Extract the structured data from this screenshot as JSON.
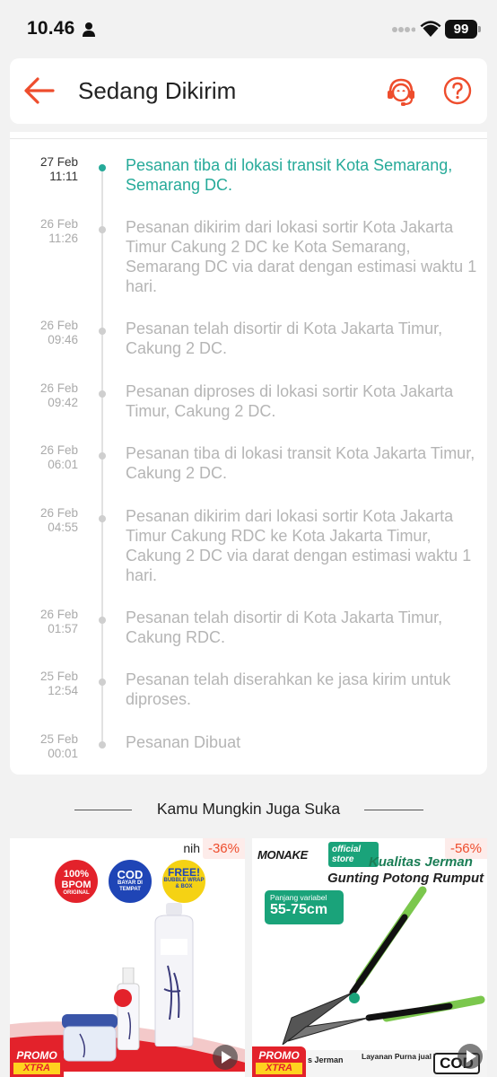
{
  "status_bar": {
    "time": "10.46",
    "battery": "99"
  },
  "header": {
    "title": "Sedang Dikirim"
  },
  "colors": {
    "accent": "#ee4d2d",
    "active_status": "#26aa99",
    "inactive_text": "#b5b5b5"
  },
  "timeline": [
    {
      "date": "27 Feb",
      "time": "11:11",
      "text": "Pesanan tiba di lokasi transit Kota Semarang, Semarang DC.",
      "active": true
    },
    {
      "date": "26 Feb",
      "time": "11:26",
      "text": "Pesanan dikirim dari lokasi sortir Kota Jakarta Timur  Cakung 2 DC ke Kota Semarang, Semarang DC via darat dengan estimasi waktu 1 hari.",
      "active": false
    },
    {
      "date": "26 Feb",
      "time": "09:46",
      "text": "Pesanan telah disortir di Kota Jakarta Timur, Cakung 2 DC.",
      "active": false
    },
    {
      "date": "26 Feb",
      "time": "09:42",
      "text": "Pesanan diproses di lokasi sortir Kota Jakarta Timur, Cakung 2 DC.",
      "active": false
    },
    {
      "date": "26 Feb",
      "time": "06:01",
      "text": "Pesanan tiba di lokasi transit Kota Jakarta Timur, Cakung 2 DC.",
      "active": false
    },
    {
      "date": "26 Feb",
      "time": "04:55",
      "text": "Pesanan dikirim dari lokasi sortir Kota Jakarta Timur  Cakung RDC ke Kota Jakarta Timur, Cakung 2 DC via darat dengan estimasi waktu 1 hari.",
      "active": false
    },
    {
      "date": "26 Feb",
      "time": "01:57",
      "text": "Pesanan telah disortir di Kota Jakarta Timur, Cakung RDC.",
      "active": false
    },
    {
      "date": "25 Feb",
      "time": "12:54",
      "text": "Pesanan telah diserahkan ke jasa kirim untuk diproses.",
      "active": false
    },
    {
      "date": "25 Feb",
      "time": "00:01",
      "text": "Pesanan Dibuat",
      "active": false
    }
  ],
  "recommendations": {
    "title": "Kamu Mungkin Juga Suka",
    "products": [
      {
        "discount": "-36%",
        "corner_text": "nih",
        "badges": {
          "bpom_main": "100% BPOM",
          "bpom_sub": "ORIGINAL",
          "cod_main": "COD",
          "cod_sub": "BAYAR DI TEMPAT",
          "free_main": "FREE!",
          "free_sub": "BUBBLE WRAP & BOX"
        },
        "promo_main": "PROMO",
        "promo_sub": "XTRA"
      },
      {
        "discount": "-56%",
        "brand": "MONAKE",
        "brand_badge": "official store",
        "headline": "Kualitas Jerman",
        "subheadline": "Gunting Potong Rumput",
        "panjang_label": "Panjang variabel",
        "panjang_value": "55-75cm",
        "feature_1": "s Jerman",
        "feature_2": "Layanan Purna jual Terjamin",
        "cod": "COD",
        "promo_main": "PROMO",
        "promo_sub": "XTRA"
      }
    ]
  }
}
